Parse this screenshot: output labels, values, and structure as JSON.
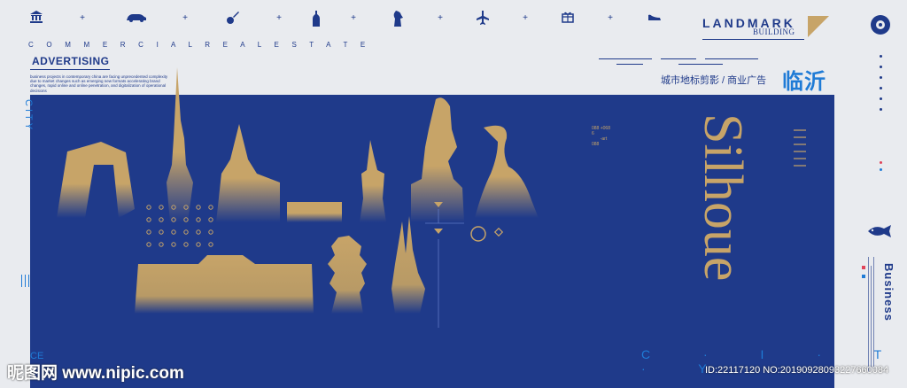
{
  "header": {
    "tagline": "C O M M E R C I A L R E A L E S T A T E",
    "advertising": "ADVERTISING",
    "advertising_body": "business projects in contemporary china are facing unprecedented complexity due to market changes such as emerging new formats accelerating brand changes, rapid online and online penetration, and digitalization of operational decisions",
    "landmark": "LANDMARK",
    "building": "BUILDING",
    "cn_subtitle": "城市地标剪影 / 商业广告",
    "cn_city": "临沂"
  },
  "icons": [
    "bank-icon",
    "car-icon",
    "guitar-icon",
    "bottle-icon",
    "statue-icon",
    "airplane-icon",
    "gift-icon",
    "shoe-icon"
  ],
  "side": {
    "city_vertical": "CITY",
    "city_bottom": "C · I · T · Y",
    "ce": "CE",
    "business": "Business"
  },
  "silhouette": "Silhouette",
  "numbers": "088 +068\n6\n       -art\n088",
  "watermark": {
    "site": "昵图网 www.nipic.com",
    "id": "ID:22117120 NO:20190928093227660084"
  },
  "colors": {
    "panel": "#1f3a8a",
    "gold": "#c7a468",
    "accent": "#1f7bd6",
    "bg": "#e9ebef"
  }
}
